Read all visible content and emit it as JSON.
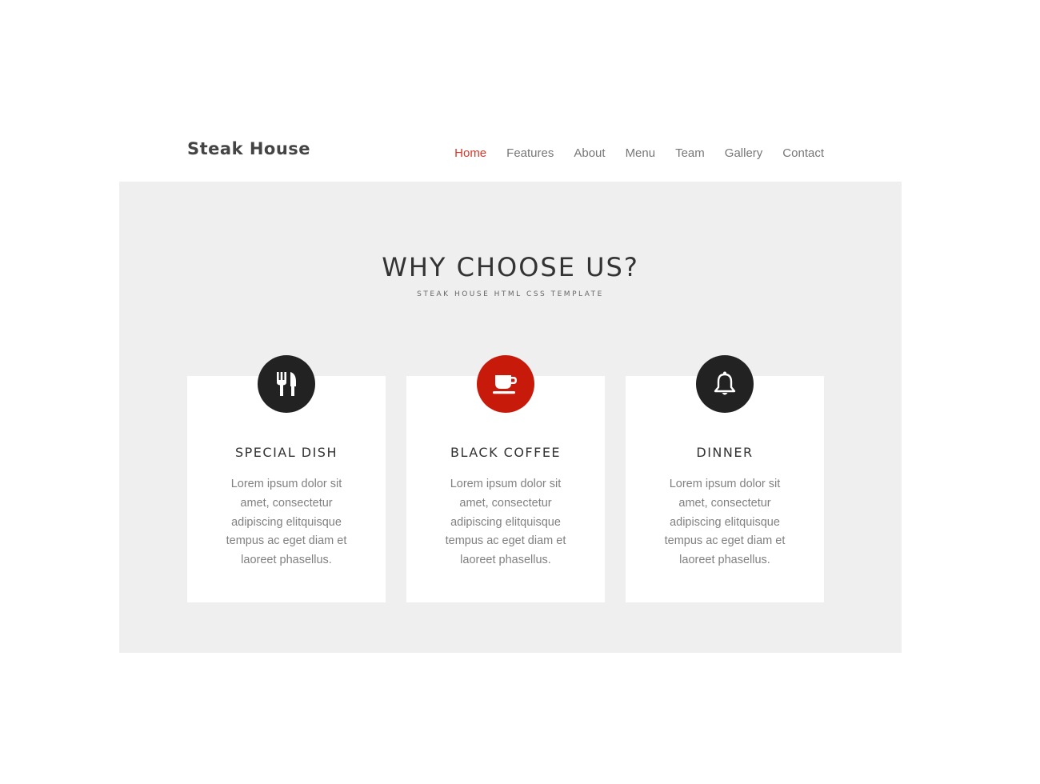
{
  "brand": {
    "name": "Steak House",
    "accent_color": "#d9382b"
  },
  "nav": {
    "items": [
      {
        "label": "Home",
        "active": true
      },
      {
        "label": "Features",
        "active": false
      },
      {
        "label": "About",
        "active": false
      },
      {
        "label": "Menu",
        "active": false
      },
      {
        "label": "Team",
        "active": false
      },
      {
        "label": "Gallery",
        "active": false
      },
      {
        "label": "Contact",
        "active": false
      }
    ]
  },
  "section": {
    "title": "WHY CHOOSE US?",
    "subtitle": "STEAK HOUSE HTML CSS TEMPLATE",
    "background_color": "#efefef",
    "cards": [
      {
        "icon": "cutlery-icon",
        "icon_color": "#222222",
        "title": "SPECIAL DISH",
        "text": "Lorem ipsum dolor sit amet, consectetur adipiscing elitquisque tempus ac eget diam et laoreet phasellus."
      },
      {
        "icon": "coffee-cup-icon",
        "icon_color": "#c81a0b",
        "title": "BLACK COFFEE",
        "text": "Lorem ipsum dolor sit amet, consectetur adipiscing elitquisque tempus ac eget diam et laoreet phasellus."
      },
      {
        "icon": "bell-icon",
        "icon_color": "#222222",
        "title": "DINNER",
        "text": "Lorem ipsum dolor sit amet, consectetur adipiscing elitquisque tempus ac eget diam et laoreet phasellus."
      }
    ]
  }
}
